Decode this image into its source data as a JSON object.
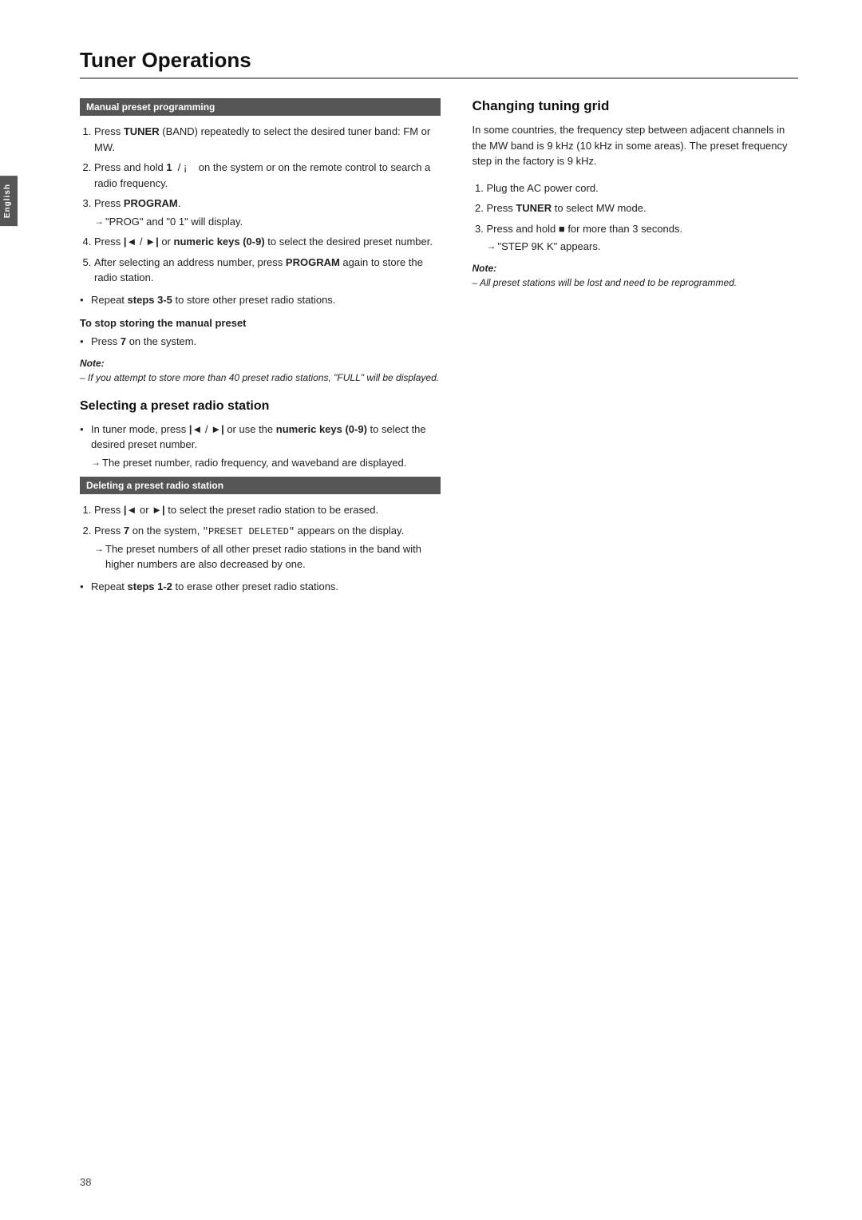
{
  "page": {
    "title": "Tuner Operations",
    "page_number": "38",
    "lang_tab": "English"
  },
  "left_column": {
    "manual_preset": {
      "heading": "Manual preset programming",
      "steps": [
        {
          "num": 1,
          "text": "Press ",
          "bold": "TUNER",
          "rest": " (BAND) repeatedly to select the desired tuner band: FM or MW."
        },
        {
          "num": 2,
          "text": "Press and hold ",
          "bold": "1",
          "rest": " / ¡    on the system or on the remote control to search a radio frequency."
        },
        {
          "num": 3,
          "text": "Press ",
          "bold": "PROGRAM",
          "rest": "."
        },
        {
          "num": 4,
          "text": "Press ",
          "bold": "◄◄",
          "mid": " / ",
          "bold2": "►► ",
          "rest": "or ",
          "bold3": "numeric keys (0-9)",
          "rest2": " to select the desired preset number."
        },
        {
          "num": 5,
          "text": "After selecting an address number, press ",
          "bold": "PROGRAM",
          "rest": " again to store the radio station."
        }
      ],
      "bullet1": "Repeat ",
      "bullet1_bold": "steps 3-5",
      "bullet1_rest": " to store other preset radio stations.",
      "arrow_note1": "\"PROG\" and \"0 1\" will display.",
      "stop_storing_heading": "To stop storing the manual preset",
      "stop_storing_text": "Press ",
      "stop_storing_bold": "7",
      "stop_storing_rest": " on the system.",
      "note_label": "Note:",
      "note_italic": "– If you attempt to store more than 40 preset radio stations, \"FULL\" will be displayed."
    },
    "selecting_preset": {
      "title": "Selecting a preset radio station",
      "bullet": "In tuner mode, press ",
      "bullet_bold1": "◄◄",
      "bullet_mid": " / ",
      "bullet_bold2": "►►",
      "bullet_rest": " or use the ",
      "bullet_bold3": "numeric keys (0-9)",
      "bullet_rest2": " to select the desired preset number.",
      "arrow_note": "The preset number, radio frequency, and waveband are displayed."
    },
    "deleting_preset": {
      "heading": "Deleting a preset radio station",
      "steps": [
        {
          "num": 1,
          "text": "Press ",
          "bold": "◄◄",
          "mid": " or ",
          "bold2": "►►",
          "rest": " to select the preset radio station to be erased."
        },
        {
          "num": 2,
          "text": "Press ",
          "bold": "7",
          "rest": " on the system, ",
          "mono": "\"PRESET  DELETED\"",
          "rest2": " appears on the display."
        }
      ],
      "arrow_note": "The preset numbers of all other preset radio stations in the band with higher numbers are also decreased by one.",
      "bullet_repeat": "Repeat ",
      "bullet_repeat_bold": "steps 1-2",
      "bullet_repeat_rest": " to erase other preset radio stations."
    }
  },
  "right_column": {
    "changing_tuning": {
      "title": "Changing tuning grid",
      "intro": "In some countries, the frequency step between adjacent channels in the MW band is 9 kHz (10 kHz in some areas). The preset frequency step in the factory is 9 kHz.",
      "steps": [
        {
          "num": 1,
          "text": "Plug the AC power cord."
        },
        {
          "num": 2,
          "text": "Press ",
          "bold": "TUNER",
          "rest": " to select MW mode."
        },
        {
          "num": 3,
          "text": "Press and hold ",
          "bold": "■",
          "rest": " for more than 3 seconds."
        }
      ],
      "arrow_note": "\"STEP  9K K\" appears.",
      "note_label": "Note:",
      "note_italic": "– All preset stations will be lost and need to be reprogrammed."
    }
  }
}
